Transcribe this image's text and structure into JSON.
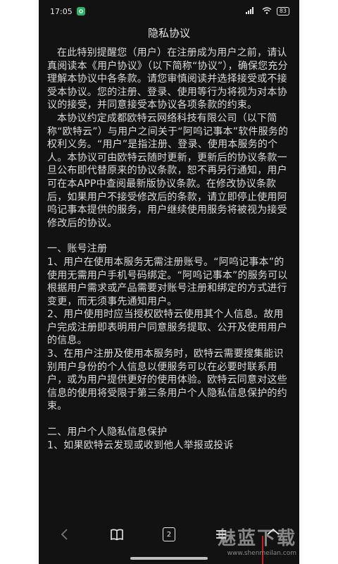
{
  "status": {
    "time": "17:05",
    "signal": "5G",
    "battery": "83"
  },
  "title": "隐私协议",
  "content": {
    "intro1": "在此特别提醒您（用户）在注册成为用户之前，请认真阅读本《用户协议》（以下简称“协议”），确保您充分理解本协议中各条款。请您审慎阅读并选择接受或不接受本协议。您的注册、登录、使用等行为将视为对本协议的接受，并同意接受本协议各项条款的约束。",
    "intro2": "本协议约定成都欧特云网络科技有限公司（以下简称“欧特云”）与用户之间关于“阿呜记事本”软件服务的权利义务。“用户”是指注册、登录、使用本服务的个人。本协议可由欧特云随时更新，更新后的协议条款一旦公布即代替原来的协议条款，恕不再另行通知，用户可在本APP中查阅最新版协议条款。在修改协议条款后，如果用户不接受修改后的条款，请立即停止使用阿呜记事本提供的服务，用户继续使用服务将被视为接受修改后的协议。",
    "section1_title": "一、账号注册",
    "s1_item1": "1、用户在使用本服务无需注册账号。“阿呜记事本”的使用无需用户手机号码绑定。“阿呜记事本”的服务可以根据用户需求或产品需要对账号注册和绑定的方式进行变更，而无须事先通知用户。",
    "s1_item2": "2、用户使用时应当授权欧特云使用其个人信息。故用户完成注册即表明用户同意服务提取、公开及使用用户的信息。",
    "s1_item3": "3、在用户注册及使用本服务时，欧特云需要搜集能识别用户身份的个人信息以便服务可以在必要时联系用户，或为用户提供更好的使用体验。欧特云同意对这些信息的使用将受限于第三条用户个人隐私信息保护的约束。",
    "section2_title": "二、用户个人隐私信息保护",
    "s2_item1": "1、如果欧特云发现或收到他人举报或投诉"
  },
  "toolbar": {
    "tab_count": "2"
  },
  "watermark": {
    "logo": "魅蓝下载",
    "url": "www.shenmeilan.com"
  },
  "icons": {
    "back": "chevron-left-icon",
    "bookmarks": "book-icon",
    "tabs": "tab-count-icon",
    "menu": "hamburger-menu-icon",
    "home": "home-icon"
  }
}
